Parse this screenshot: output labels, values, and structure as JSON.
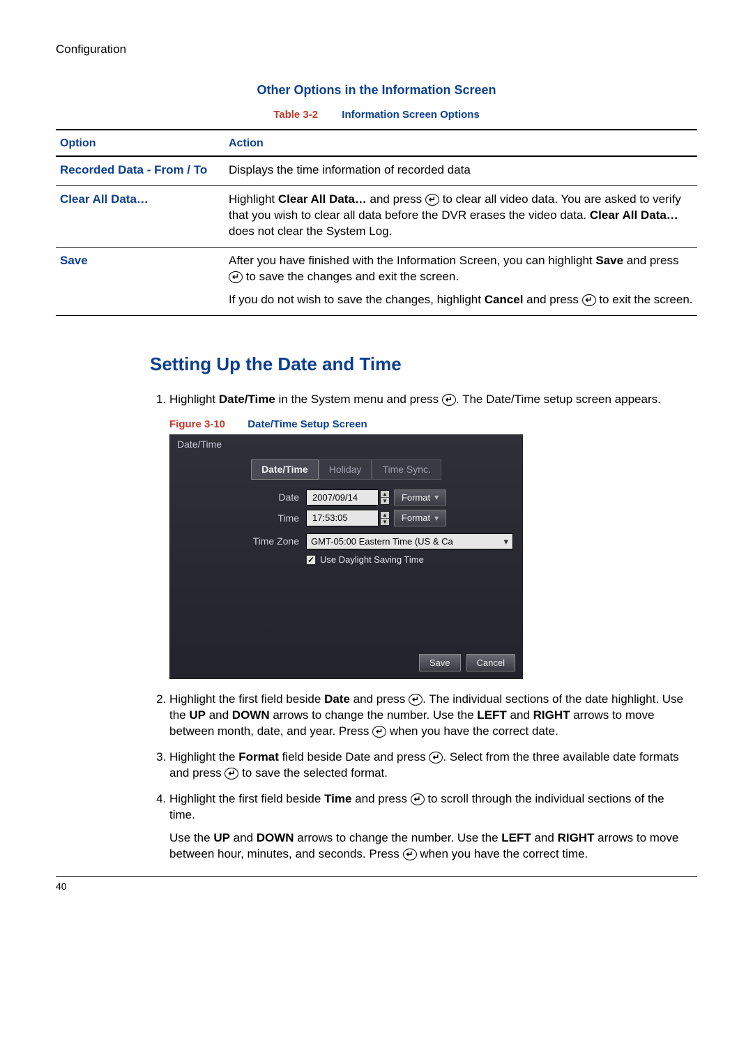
{
  "header": "Configuration",
  "section1": {
    "title": "Other Options in the Information Screen",
    "table_label": "Table 3-2",
    "table_title": "Information Screen Options",
    "col_option": "Option",
    "col_action": "Action",
    "rows": [
      {
        "option": "Recorded Data - From / To",
        "action_plain": "Displays the time information of recorded data"
      },
      {
        "option": "Clear All Data…",
        "a1": "Highlight ",
        "b1": "Clear All Data…",
        "a2": " and press ",
        "a3": " to clear all video data. You are asked to verify that you wish to clear all data before the DVR erases the video data. ",
        "b2": "Clear All Data…",
        "a4": " does not clear the System Log."
      },
      {
        "option": "Save",
        "a1": "After you have finished with the Information Screen, you can highlight ",
        "b1": "Save",
        "a2": " and press ",
        "a3": " to save the changes and exit the screen.",
        "p2a": "If you do not wish to save the changes, highlight ",
        "p2b": "Cancel",
        "p2c": " and press ",
        "p2d": " to exit the screen."
      }
    ]
  },
  "section2": {
    "title": "Setting Up the Date and Time",
    "steps": {
      "s1a": "Highlight ",
      "s1b": "Date/Time",
      "s1c": " in the System menu and press ",
      "s1d": ". The Date/Time setup screen appears.",
      "fig_label": "Figure 3-10",
      "fig_title": "Date/Time Setup Screen",
      "s2a": "Highlight the first field beside ",
      "s2b": "Date",
      "s2c": " and press ",
      "s2d": ". The individual sections of the date highlight. Use the ",
      "s2e": "UP",
      "s2f": " and ",
      "s2g": "DOWN",
      "s2h": " arrows to change the number. Use the ",
      "s2i": "LEFT",
      "s2j": " and ",
      "s2k": "RIGHT",
      "s2l": " arrows to move between month, date, and year. Press ",
      "s2m": " when you have the correct date.",
      "s3a": "Highlight the ",
      "s3b": "Format",
      "s3c": " field beside Date and press ",
      "s3d": ". Select from the three available date formats and press ",
      "s3e": " to save the selected format.",
      "s4a": "Highlight the first field beside ",
      "s4b": "Time",
      "s4c": " and press ",
      "s4d": " to scroll through the individual sections of the time.",
      "s4pa": "Use the ",
      "s4pb": "UP",
      "s4pc": " and ",
      "s4pd": "DOWN",
      "s4pe": " arrows to change the number. Use the ",
      "s4pf": "LEFT",
      "s4pg": " and ",
      "s4ph": "RIGHT",
      "s4pi": " arrows to move between hour, minutes, and seconds. Press ",
      "s4pj": " when you have the correct time."
    }
  },
  "screenshot": {
    "title": "Date/Time",
    "tabs": {
      "t1": "Date/Time",
      "t2": "Holiday",
      "t3": "Time Sync."
    },
    "labels": {
      "date": "Date",
      "time": "Time",
      "tz": "Time Zone"
    },
    "date_value": "2007/09/14",
    "time_value": "17:53:05",
    "format_btn": "Format",
    "tz_value": "GMT-05:00  Eastern Time (US & Ca",
    "dst_label": "Use Daylight Saving Time",
    "save": "Save",
    "cancel": "Cancel"
  },
  "enter_glyph": "↵",
  "page_number": "40"
}
